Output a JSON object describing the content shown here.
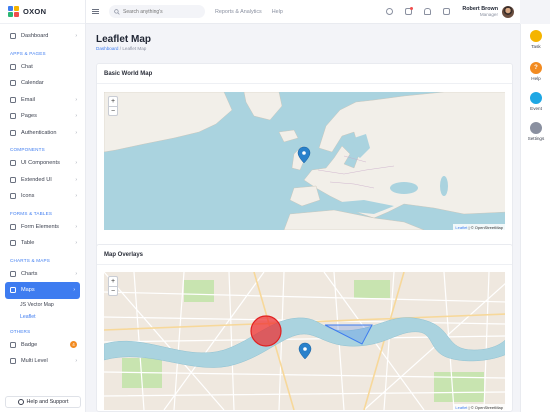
{
  "brand": {
    "name": "OXON"
  },
  "sidebar": {
    "items": [
      {
        "type": "item",
        "label": "Dashboard",
        "chevron": true
      },
      {
        "type": "section",
        "label": "APPS & PAGES"
      },
      {
        "type": "item",
        "label": "Chat"
      },
      {
        "type": "item",
        "label": "Calendar"
      },
      {
        "type": "item",
        "label": "Email",
        "chevron": true
      },
      {
        "type": "item",
        "label": "Pages",
        "chevron": true
      },
      {
        "type": "item",
        "label": "Authentication",
        "chevron": true
      },
      {
        "type": "section",
        "label": "COMPONENTS"
      },
      {
        "type": "item",
        "label": "UI Components",
        "chevron": true
      },
      {
        "type": "item",
        "label": "Extended UI",
        "chevron": true
      },
      {
        "type": "item",
        "label": "Icons",
        "chevron": true
      },
      {
        "type": "section",
        "label": "FORMS & TABLES"
      },
      {
        "type": "item",
        "label": "Form Elements",
        "chevron": true
      },
      {
        "type": "item",
        "label": "Table",
        "chevron": true
      },
      {
        "type": "section",
        "label": "CHARTS & MAPS"
      },
      {
        "type": "item",
        "label": "Charts",
        "chevron": true
      },
      {
        "type": "item",
        "label": "Maps",
        "chevron": true,
        "active": true
      },
      {
        "type": "sub",
        "label": "JS Vector Map"
      },
      {
        "type": "sub",
        "label": "Leaflet",
        "current": true
      },
      {
        "type": "section",
        "label": "OTHERS"
      },
      {
        "type": "item",
        "label": "Badge",
        "badge": "4"
      },
      {
        "type": "item",
        "label": "Multi Level",
        "chevron": true
      }
    ],
    "help_label": "Help and Support"
  },
  "header": {
    "search_placeholder": "Search anything's",
    "links": [
      "Reports & Analytics",
      "Help"
    ],
    "user_name": "Robert Brown",
    "user_role": "Manager",
    "icons": [
      "sun-icon",
      "gift-icon",
      "bell-icon",
      "cart-icon"
    ]
  },
  "rail": [
    {
      "label": "Task",
      "color": "#f5b400",
      "icon": "task-icon"
    },
    {
      "label": "Help",
      "color": "#f28b21",
      "icon": "help-icon"
    },
    {
      "label": "Event",
      "color": "#1ea7e4",
      "icon": "event-icon"
    },
    {
      "label": "Settings",
      "color": "#8a90a0",
      "icon": "gear-icon"
    }
  ],
  "page": {
    "title": "Leaflet Map",
    "breadcrumb": [
      "Dashboard",
      "Leaflet Map"
    ]
  },
  "cards": {
    "basic": {
      "title": "Basic World Map"
    },
    "overlays": {
      "title": "Map Overlays"
    }
  },
  "map": {
    "zoom_in": "+",
    "zoom_out": "−",
    "attribution_link": "Leaflet",
    "attribution_text": "| © OpenStreetMap",
    "water_color": "#aad3df",
    "land_color": "#f2efe9",
    "marker_color": "#2a81cb"
  }
}
